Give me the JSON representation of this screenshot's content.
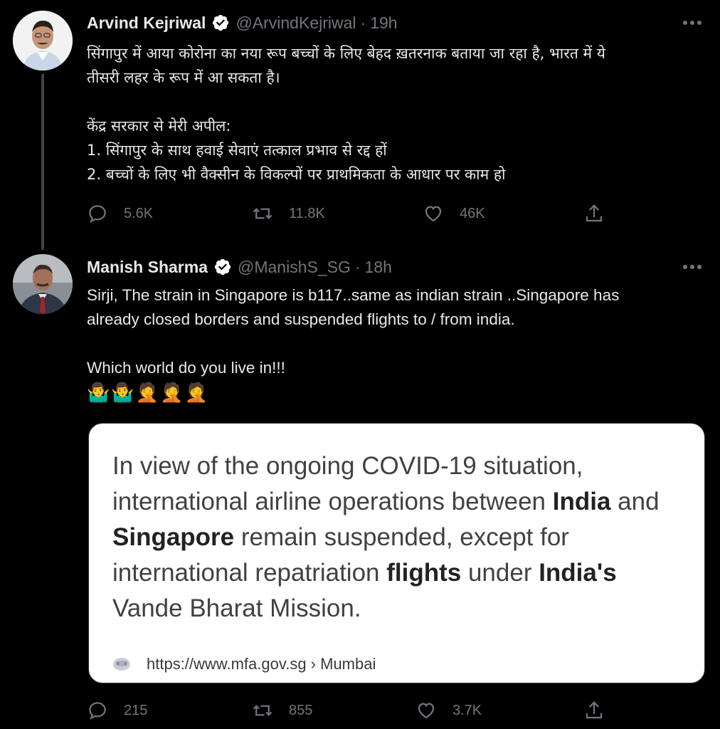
{
  "tweet1": {
    "name": "Arvind Kejriwal",
    "handle": "@ArvindKejriwal",
    "separator": "·",
    "time": "19h",
    "body_lines": [
      "सिंगापुर में आया कोरोना का नया रूप बच्चों के लिए बेहद ख़तरनाक बताया जा रहा है, भारत में ये",
      "तीसरी लहर के रूप में आ सकता है।",
      "",
      "केंद्र सरकार से मेरी अपील:",
      "1. सिंगापुर के साथ हवाई सेवाएं तत्काल प्रभाव से रद्द हों",
      "2. बच्चों के लिए भी वैक्सीन के विकल्पों पर प्राथमिकता के आधार पर काम हो"
    ],
    "replies": "5.6K",
    "retweets": "11.8K",
    "likes": "46K"
  },
  "tweet2": {
    "name": "Manish Sharma",
    "handle": "@ManishS_SG",
    "separator": "·",
    "time": "18h",
    "body_lines": [
      "Sirji, The strain in Singapore is b117..same as indian strain  ..Singapore has",
      "already closed borders and suspended flights to / from india.",
      "",
      "Which world do you live in!!!"
    ],
    "emojis": "🤷‍♂️🤷‍♂️🤦🤦🤦",
    "card": {
      "text_parts": {
        "p1": "In view of the ongoing COVID-19 situation, international airline operations between ",
        "b1": "India",
        "p2": " and ",
        "b2": "Singapore",
        "p3": " remain suspended, except for international repatriation ",
        "b3": "flights",
        "p4": " under ",
        "b4": "India's",
        "p5": " Vande Bharat Mission."
      },
      "url": "https://www.mfa.gov.sg › Mumbai"
    },
    "replies": "215",
    "retweets": "855",
    "likes": "3.7K"
  },
  "colors": {
    "background": "#000000",
    "text": "#e7e9ea",
    "secondary": "#71767b",
    "verified_badge": "#ffffff"
  },
  "icons": [
    "verified-icon",
    "more-icon",
    "reply-icon",
    "retweet-icon",
    "like-icon",
    "share-icon",
    "mfa-seal-icon"
  ]
}
